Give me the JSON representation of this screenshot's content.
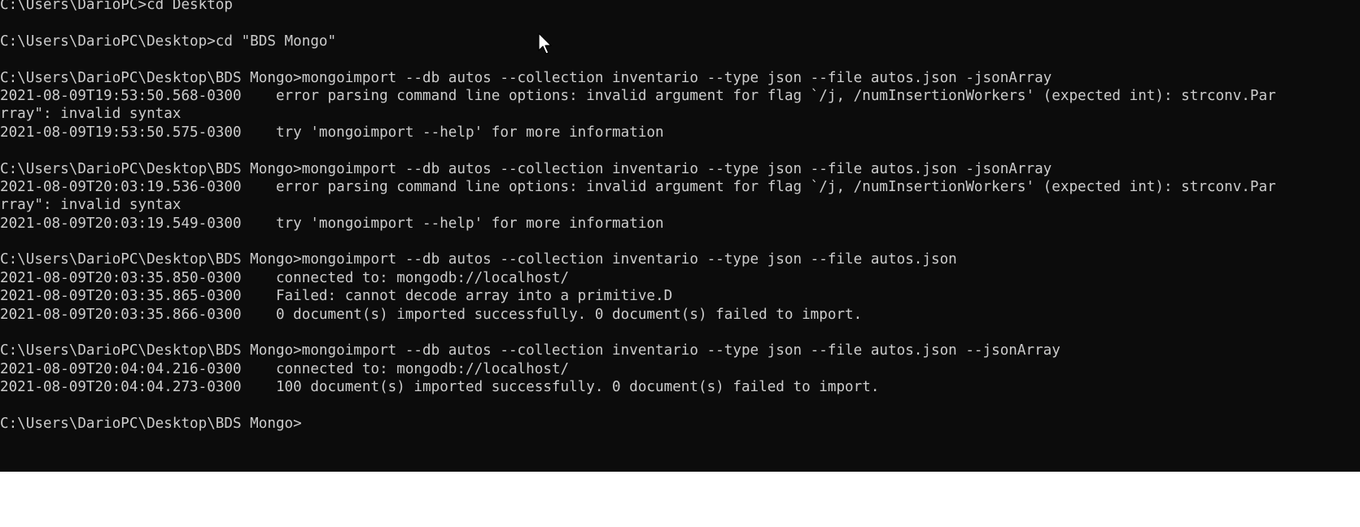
{
  "terminal": {
    "lines": [
      "C:\\Users\\DarioPC>cd Desktop",
      "",
      "C:\\Users\\DarioPC\\Desktop>cd \"BDS Mongo\"",
      "",
      "C:\\Users\\DarioPC\\Desktop\\BDS Mongo>mongoimport --db autos --collection inventario --type json --file autos.json -jsonArray",
      "2021-08-09T19:53:50.568-0300    error parsing command line options: invalid argument for flag `/j, /numInsertionWorkers' (expected int): strconv.Par",
      "rray\": invalid syntax",
      "2021-08-09T19:53:50.575-0300    try 'mongoimport --help' for more information",
      "",
      "C:\\Users\\DarioPC\\Desktop\\BDS Mongo>mongoimport --db autos --collection inventario --type json --file autos.json -jsonArray",
      "2021-08-09T20:03:19.536-0300    error parsing command line options: invalid argument for flag `/j, /numInsertionWorkers' (expected int): strconv.Par",
      "rray\": invalid syntax",
      "2021-08-09T20:03:19.549-0300    try 'mongoimport --help' for more information",
      "",
      "C:\\Users\\DarioPC\\Desktop\\BDS Mongo>mongoimport --db autos --collection inventario --type json --file autos.json",
      "2021-08-09T20:03:35.850-0300    connected to: mongodb://localhost/",
      "2021-08-09T20:03:35.865-0300    Failed: cannot decode array into a primitive.D",
      "2021-08-09T20:03:35.866-0300    0 document(s) imported successfully. 0 document(s) failed to import.",
      "",
      "C:\\Users\\DarioPC\\Desktop\\BDS Mongo>mongoimport --db autos --collection inventario --type json --file autos.json --jsonArray",
      "2021-08-09T20:04:04.216-0300    connected to: mongodb://localhost/",
      "2021-08-09T20:04:04.273-0300    100 document(s) imported successfully. 0 document(s) failed to import.",
      "",
      "C:\\Users\\DarioPC\\Desktop\\BDS Mongo>"
    ],
    "colors": {
      "background": "#0c0c0c",
      "text": "#cccccc"
    },
    "pointer_icon": "mouse-pointer-icon"
  }
}
